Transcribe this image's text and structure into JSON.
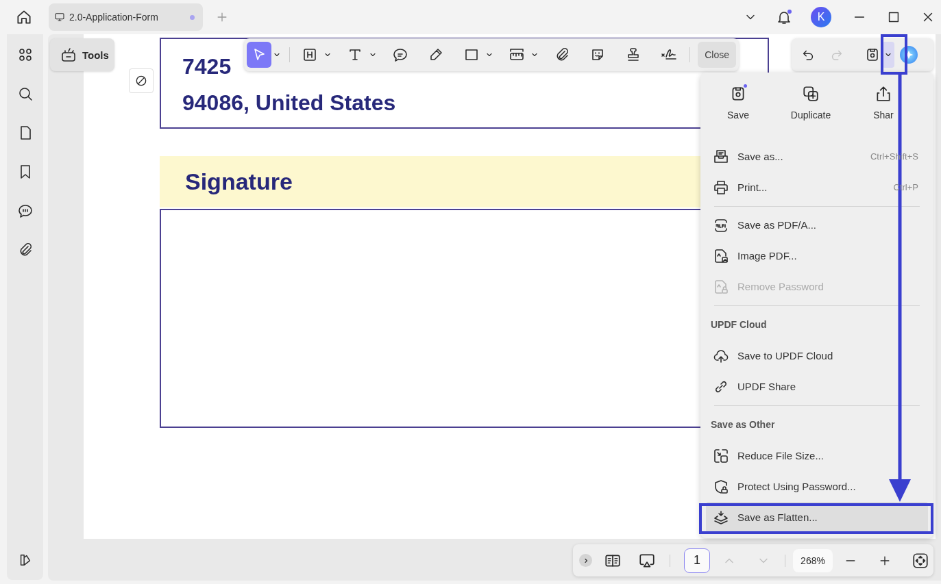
{
  "tabs": [
    {
      "label": "2.0-Application-Form",
      "selected": true,
      "modified": true
    }
  ],
  "notifications": {
    "unread": true
  },
  "account": {
    "initial": "K"
  },
  "tools_button": {
    "label": "Tools"
  },
  "annotation_toolbar": {
    "tools": [
      {
        "selected": true,
        "dropdown": true
      },
      {
        "selected": false,
        "dropdown": true
      },
      {
        "selected": false,
        "dropdown": true
      },
      {
        "selected": false,
        "dropdown": false
      },
      {
        "selected": false,
        "dropdown": false
      },
      {
        "selected": false,
        "dropdown": true
      },
      {
        "selected": false,
        "dropdown": true
      },
      {
        "selected": false,
        "dropdown": false
      },
      {
        "selected": false,
        "dropdown": false
      },
      {
        "selected": false,
        "dropdown": false
      },
      {
        "selected": false,
        "dropdown": false
      }
    ],
    "close_label": "Close"
  },
  "document": {
    "address_lines": [
      "7425",
      "94086, United States"
    ],
    "section_title": "Signature"
  },
  "file_menu": {
    "quick_actions": [
      {
        "label": "Save",
        "badge": true
      },
      {
        "label": "Duplicate",
        "badge": false
      },
      {
        "label": "Shar",
        "badge": false
      }
    ],
    "items": [
      {
        "kind": "item",
        "label": "Save as...",
        "shortcut": "Ctrl+Shift+S",
        "disabled": false,
        "selected": false
      },
      {
        "kind": "item",
        "label": "Print...",
        "shortcut": "Ctrl+P",
        "disabled": false,
        "selected": false
      },
      {
        "kind": "divider"
      },
      {
        "kind": "item",
        "label": "Save as PDF/A...",
        "disabled": false,
        "selected": false
      },
      {
        "kind": "item",
        "label": "Image PDF...",
        "disabled": false,
        "selected": false
      },
      {
        "kind": "item",
        "label": "Remove Password",
        "disabled": true,
        "selected": false
      },
      {
        "kind": "divider"
      },
      {
        "kind": "heading",
        "label": "UPDF Cloud"
      },
      {
        "kind": "item",
        "label": "Save to UPDF Cloud",
        "disabled": false,
        "selected": false
      },
      {
        "kind": "item",
        "label": "UPDF Share",
        "disabled": false,
        "selected": false
      },
      {
        "kind": "divider"
      },
      {
        "kind": "heading",
        "label": "Save as Other"
      },
      {
        "kind": "item",
        "label": "Reduce File Size...",
        "disabled": false,
        "selected": false
      },
      {
        "kind": "item",
        "label": "Protect Using Password...",
        "disabled": false,
        "selected": false
      },
      {
        "kind": "item",
        "label": "Save as Flatten...",
        "disabled": false,
        "selected": true
      }
    ]
  },
  "bottom_bar": {
    "page": "1",
    "zoom": "268%"
  }
}
